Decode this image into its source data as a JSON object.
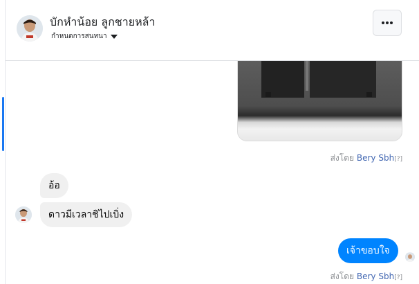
{
  "header": {
    "contact_name": "บักหำน้อย ลูกชายหล้า",
    "settings_label": "กำหนดการสนทนา",
    "more_label": "ตัวเลือกเพิ่มเติม"
  },
  "thread": {
    "image_message": {
      "sent_by_prefix": "ส่งโดย",
      "sent_by_name": "Bery Sbh",
      "sent_by_help": "[?]"
    },
    "messages": [
      {
        "direction": "incoming",
        "text": "อ้อ"
      },
      {
        "direction": "incoming",
        "text": "ดาวมีเวลาชิไปเบิ่ง"
      },
      {
        "direction": "outgoing",
        "text": "เจ้าขอบใจ"
      }
    ],
    "last_sent_by": {
      "sent_by_prefix": "ส่งโดย",
      "sent_by_name": "Bery Sbh",
      "sent_by_help": "[?]"
    }
  },
  "colors": {
    "outgoing_bubble": "#0084ff",
    "incoming_bubble": "#f0f0f0",
    "sender_link": "#4267b2",
    "accent": "#1877f2"
  },
  "icons": {
    "more": "ellipsis-icon",
    "settings": "caret-down-icon"
  }
}
